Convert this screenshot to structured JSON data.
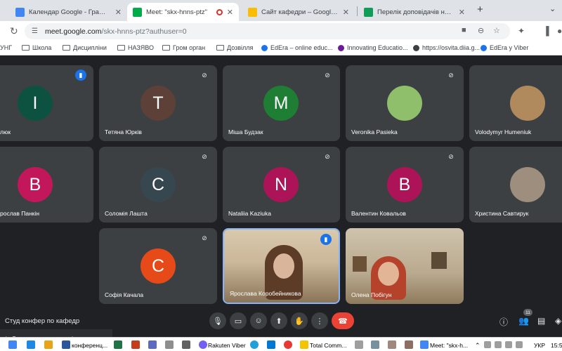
{
  "browser": {
    "tabs": [
      {
        "title": "Календар Google - Графік по",
        "color": "#4285f4"
      },
      {
        "title": "Meet: \"skx-hnns-ptz\"",
        "color": "#00ac47"
      },
      {
        "title": "Сайт кафедри – Google Диск",
        "color": "#fbbc04"
      },
      {
        "title": "Перелік доповідачів на студ к",
        "color": "#0f9d58"
      }
    ],
    "new_tab": "+",
    "tab_menu": "⌄",
    "url_host": "meet.google.com",
    "url_path": "/skx-hnns-ptz?authuser=0",
    "bookmarks": [
      "УНГ",
      "Школа",
      "Дисципліни",
      "НАЗЯВО",
      "Гром орган",
      "Дозвілля",
      "EdEra – online educ...",
      "Innovating Educatio...",
      "https://osvita.diia.g...",
      "EdEra у Viber"
    ]
  },
  "meeting": {
    "name": "Студ конфер по кафедр",
    "participants_count": "11",
    "toast": "мія Лашта залишає зустріч",
    "tiles": [
      {
        "name": "люк",
        "initial": "I",
        "color": "#0d5241"
      },
      {
        "name": "Тетяна Юрків",
        "initial": "T",
        "color": "#5d4037"
      },
      {
        "name": "Міша Будзак",
        "initial": "M",
        "color": "#1e7e34"
      },
      {
        "name": "Veronika Pasieka",
        "initial": "",
        "color": "#8fbf6a"
      },
      {
        "name": "Volodymyr Humeniuk",
        "initial": "",
        "color": "#b08a5c"
      },
      {
        "name": "рослав Панкін",
        "initial": "B",
        "color": "#c2185b"
      },
      {
        "name": "Соломія Лашта",
        "initial": "C",
        "color": "#37474f"
      },
      {
        "name": "Nataliia Kaziuka",
        "initial": "N",
        "color": "#ad1457"
      },
      {
        "name": "Валентин Ковальов",
        "initial": "B",
        "color": "#ad1457"
      },
      {
        "name": "Христина Савтирук",
        "initial": "",
        "color": "#9e8e7e"
      },
      {
        "name": "Софія Качала",
        "initial": "C",
        "color": "#e64a19"
      },
      {
        "name": "Ярослава Коробейникова",
        "initial": "",
        "color": "#cbb79a"
      },
      {
        "name": "Олена Побігун",
        "initial": "",
        "color": "#b08f6a"
      }
    ]
  },
  "taskbar": {
    "items": [
      "конференц...",
      "Rakuten Viber",
      "Total Comm...",
      "Meet: \"skx-h..."
    ],
    "lang": "УКР",
    "time": "15:5"
  }
}
